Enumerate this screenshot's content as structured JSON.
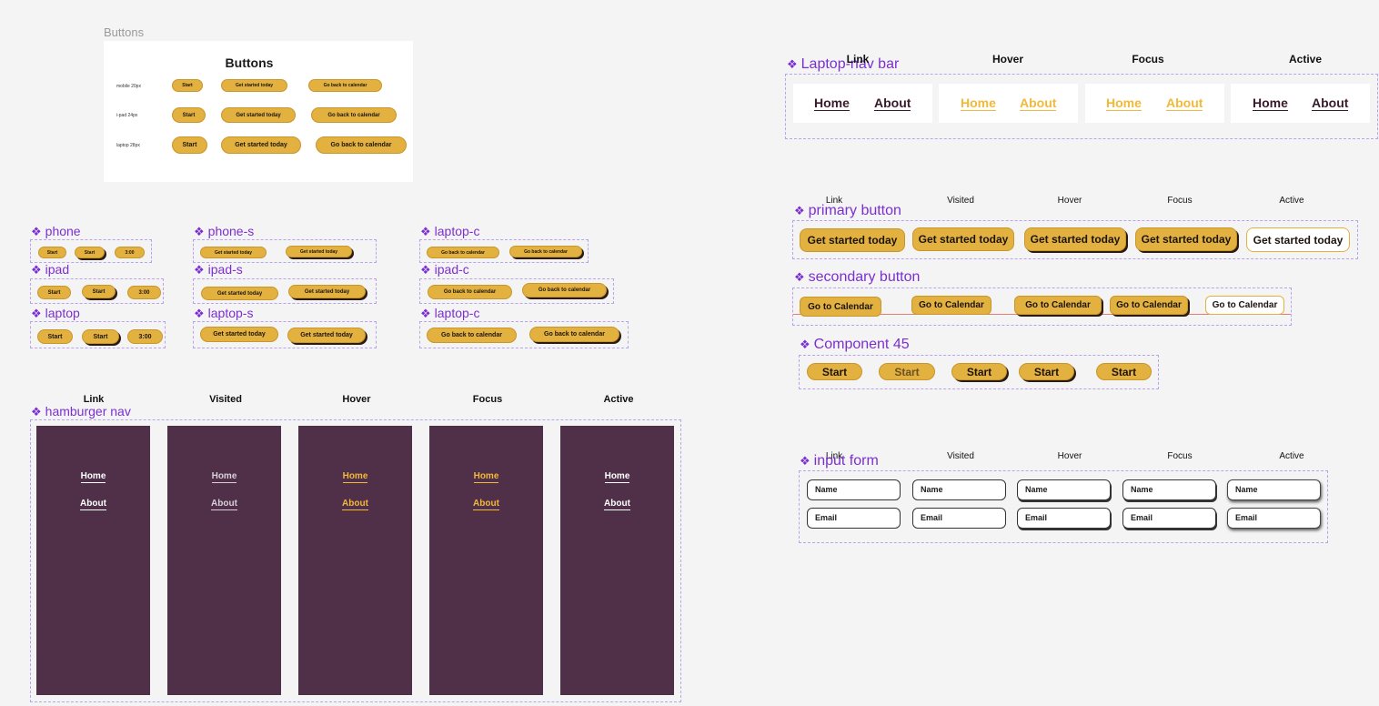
{
  "buttons_frame": {
    "frame_title": "Buttons",
    "title": "Buttons",
    "rows": [
      {
        "label": "mobile 20px",
        "start": "Start",
        "get_started": "Get started today",
        "back": "Go back to calendar"
      },
      {
        "label": "i-pad 24px",
        "start": "Start",
        "get_started": "Get started today",
        "back": "Go back to calendar"
      },
      {
        "label": "laptop 28px",
        "start": "Start",
        "get_started": "Get started today",
        "back": "Go back to calendar"
      }
    ]
  },
  "components_left": {
    "phone": {
      "label": "phone",
      "b1": "Start",
      "b2": "Start",
      "b3": "3:00"
    },
    "ipad": {
      "label": "ipad",
      "b1": "Start",
      "b2": "Start",
      "b3": "3:00"
    },
    "laptop": {
      "label": "laptop",
      "b1": "Start",
      "b2": "Start",
      "b3": "3:00"
    },
    "phone_s": {
      "label": "phone-s",
      "b1": "Get started today",
      "b2": "Get started today"
    },
    "ipad_s": {
      "label": "ipad-s",
      "b1": "Get started today",
      "b2": "Get started today"
    },
    "laptop_s": {
      "label": "laptop-s",
      "b1": "Get started today",
      "b2": "Get started today"
    },
    "laptop_c1": {
      "label": "laptop-c",
      "b1": "Go back to calendar",
      "b2": "Go back to calendar"
    },
    "ipad_c": {
      "label": "ipad-c",
      "b1": "Go back to calendar",
      "b2": "Go back to calendar"
    },
    "laptop_c2": {
      "label": "laptop-c",
      "b1": "Go back to calendar",
      "b2": "Go back to calendar"
    }
  },
  "hamburger": {
    "label": "hamburger nav",
    "states": [
      "Link",
      "Visited",
      "Hover",
      "Focus",
      "Active"
    ],
    "home": "Home",
    "about": "About"
  },
  "laptop_nav": {
    "label": "Laptop-nav bar",
    "states": [
      "Link",
      "Hover",
      "Focus",
      "Active"
    ],
    "home": "Home",
    "about": "About"
  },
  "primary": {
    "label": "primary button",
    "states": [
      "Link",
      "Visited",
      "Hover",
      "Focus",
      "Active"
    ],
    "text": "Get started today"
  },
  "secondary": {
    "label": "secondary button",
    "text": "Go to Calendar"
  },
  "component45": {
    "label": "Component 45",
    "text": "Start"
  },
  "input_form": {
    "label": "input form",
    "states": [
      "Link",
      "Visited",
      "Hover",
      "Focus",
      "Active"
    ],
    "name": "Name",
    "email": "Email"
  },
  "colors": {
    "accent": "#e2b13f",
    "nav_bg": "#4f3048",
    "component_label": "#7b2fd0",
    "hover_text": "#f2b93a"
  }
}
